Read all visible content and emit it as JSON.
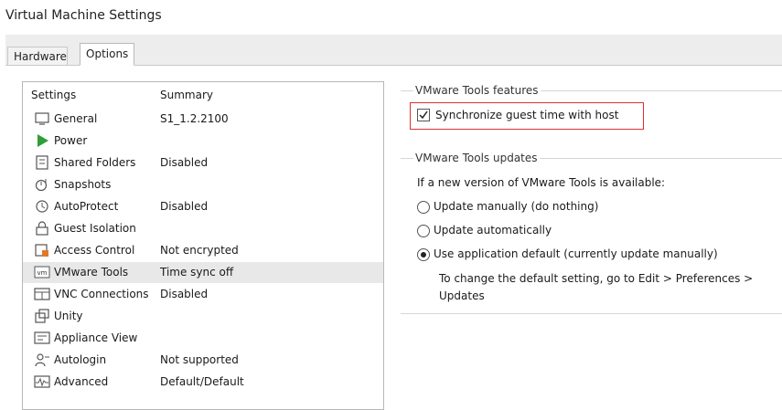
{
  "window": {
    "title": "Virtual Machine Settings"
  },
  "tabs": [
    {
      "label": "Hardware",
      "active": false
    },
    {
      "label": "Options",
      "active": true
    }
  ],
  "settings_list": {
    "headers": {
      "settings": "Settings",
      "summary": "Summary"
    },
    "items": [
      {
        "icon": "general-icon",
        "label": "General",
        "summary": "S1_1.2.2100"
      },
      {
        "icon": "power-icon",
        "label": "Power",
        "summary": ""
      },
      {
        "icon": "shared-folders-icon",
        "label": "Shared Folders",
        "summary": "Disabled"
      },
      {
        "icon": "snapshots-icon",
        "label": "Snapshots",
        "summary": ""
      },
      {
        "icon": "autoprotect-icon",
        "label": "AutoProtect",
        "summary": "Disabled"
      },
      {
        "icon": "lock-icon",
        "label": "Guest Isolation",
        "summary": ""
      },
      {
        "icon": "access-control-icon",
        "label": "Access Control",
        "summary": "Not encrypted"
      },
      {
        "icon": "vmware-tools-icon",
        "label": "VMware Tools",
        "summary": "Time sync off",
        "selected": true
      },
      {
        "icon": "vnc-icon",
        "label": "VNC Connections",
        "summary": "Disabled"
      },
      {
        "icon": "unity-icon",
        "label": "Unity",
        "summary": ""
      },
      {
        "icon": "appliance-view-icon",
        "label": "Appliance View",
        "summary": ""
      },
      {
        "icon": "autologin-icon",
        "label": "Autologin",
        "summary": "Not supported"
      },
      {
        "icon": "advanced-icon",
        "label": "Advanced",
        "summary": "Default/Default"
      }
    ]
  },
  "features": {
    "title": "VMware Tools features",
    "sync_label": "Synchronize guest time with host",
    "sync_checked": true,
    "highlight_color": "#e03030"
  },
  "updates": {
    "title": "VMware Tools updates",
    "prompt": "If a new version of VMware Tools is available:",
    "options": [
      {
        "label": "Update manually (do nothing)",
        "selected": false
      },
      {
        "label": "Update automatically",
        "selected": false
      },
      {
        "label": "Use application default (currently update manually)",
        "selected": true
      }
    ],
    "note_line1": "To change the default setting, go to Edit > Preferences >",
    "note_line2": "Updates"
  }
}
